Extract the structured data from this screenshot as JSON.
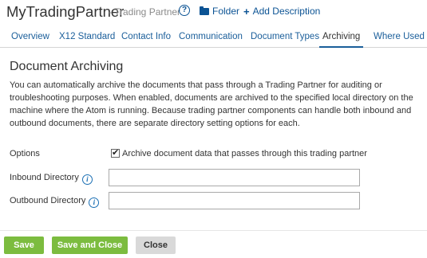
{
  "header": {
    "title": "MyTradingPartner",
    "subtitle": "- Trading Partner",
    "help_glyph": "?",
    "folder_label": "Folder",
    "add_description_label": "Add Description"
  },
  "tabs": [
    {
      "label": "Overview",
      "active": false
    },
    {
      "label": "X12 Standard",
      "active": false
    },
    {
      "label": "Contact Info",
      "active": false
    },
    {
      "label": "Communication",
      "active": false
    },
    {
      "label": "Document Types",
      "active": false
    },
    {
      "label": "Archiving",
      "active": true
    },
    {
      "label": "Where Used",
      "active": false
    }
  ],
  "section": {
    "title": "Document Archiving",
    "description": "You can automatically archive the documents that pass through a Trading Partner for auditing or troubleshooting purposes. When enabled, documents are archived to the specified local directory on the machine where the Atom is running. Because trading partner components can handle both inbound and outbound documents, there are separate directory setting options for each."
  },
  "form": {
    "options_label": "Options",
    "archive_checkbox": {
      "label": "Archive document data that passes through this trading partner",
      "checked": true,
      "check_glyph": "✔"
    },
    "inbound": {
      "label": "Inbound Directory",
      "value": "",
      "info_glyph": "i"
    },
    "outbound": {
      "label": "Outbound Directory",
      "value": "",
      "info_glyph": "i"
    }
  },
  "buttons": {
    "save": "Save",
    "save_and_close": "Save and Close",
    "close": "Close"
  },
  "colors": {
    "link": "#0b5394",
    "tab_link": "#1a5e9a",
    "primary_button": "#7cbc3f",
    "secondary_button": "#d9d9d9"
  },
  "icons": [
    "help-icon",
    "folder-icon",
    "plus-icon",
    "info-icon",
    "checkmark-icon"
  ]
}
